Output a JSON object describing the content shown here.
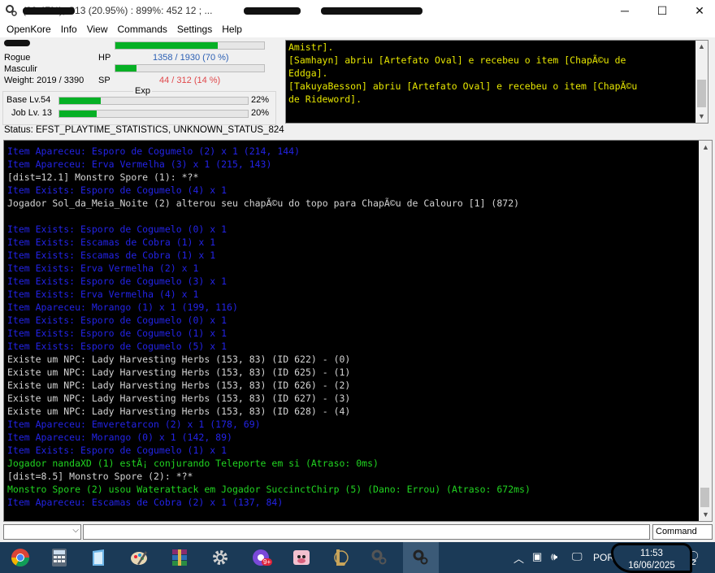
{
  "window": {
    "title": "(22.47%), C13 (20.95%) : 899%: 452 12 ; ...",
    "minimize_glyph": "─",
    "maximize_glyph": "☐",
    "close_glyph": "✕"
  },
  "menu": [
    "OpenKore",
    "Info",
    "View",
    "Commands",
    "Settings",
    "Help"
  ],
  "character": {
    "class": "Rogue",
    "sex": "Masculir",
    "weight": "Weight: 2019 / 3390",
    "hp_label": "HP",
    "hp_text": "1358 / 1930 (70 %)",
    "hp_fraction": 0.7,
    "sp_label": "SP",
    "sp_text": "44 / 312 (14 %)",
    "sp_fraction": 0.14,
    "top_bar_fraction": 0.69,
    "exp_label": "Exp",
    "base_label": "Base Lv.54",
    "base_pct": "22%",
    "base_fraction": 0.22,
    "job_label": "Job Lv. 13",
    "job_pct": "20%",
    "job_fraction": 0.2
  },
  "chat": [
    "Amistr].",
    "[Samhayn] abriu [Artefato Oval] e recebeu o item [ChapÃ©u de",
    "Eddga].",
    "[TakuyaBesson] abriu [Artefato Oval] e recebeu o item [ChapÃ©u",
    "de Rideword]."
  ],
  "status": "Status: EFST_PLAYTIME_STATISTICS, UNKNOWN_STATUS_824",
  "console_lines": [
    {
      "t": "Item Apareceu: Esporo de Cogumelo (2) x 1 (214, 144)",
      "c": "blue"
    },
    {
      "t": "Item Apareceu: Erva Vermelha (3) x 1 (215, 143)",
      "c": "blue"
    },
    {
      "t": "[dist=12.1] Monstro Spore (1): *?*",
      "c": "gray"
    },
    {
      "t": "Item Exists: Esporo de Cogumelo (4) x 1",
      "c": "blue"
    },
    {
      "t": "Jogador Sol_da_Meia_Noite (2) alterou seu chapÃ©u do topo para ChapÃ©u de Calouro [1] (872)",
      "c": "gray"
    },
    {
      "t": "",
      "c": "gray"
    },
    {
      "t": "Item Exists: Esporo de Cogumelo (0) x 1",
      "c": "blue"
    },
    {
      "t": "Item Exists: Escamas de Cobra (1) x 1",
      "c": "blue"
    },
    {
      "t": "Item Exists: Escamas de Cobra (1) x 1",
      "c": "blue"
    },
    {
      "t": "Item Exists: Erva Vermelha (2) x 1",
      "c": "blue"
    },
    {
      "t": "Item Exists: Esporo de Cogumelo (3) x 1",
      "c": "blue"
    },
    {
      "t": "Item Exists: Erva Vermelha (4) x 1",
      "c": "blue"
    },
    {
      "t": "Item Apareceu: Morango (1) x 1 (199, 116)",
      "c": "blue"
    },
    {
      "t": "Item Exists: Esporo de Cogumelo (0) x 1",
      "c": "blue"
    },
    {
      "t": "Item Exists: Esporo de Cogumelo (1) x 1",
      "c": "blue"
    },
    {
      "t": "Item Exists: Esporo de Cogumelo (5) x 1",
      "c": "blue"
    },
    {
      "t": "Existe um NPC: Lady Harvesting Herbs (153, 83) (ID 622) - (0)",
      "c": "gray"
    },
    {
      "t": "Existe um NPC: Lady Harvesting Herbs (153, 83) (ID 625) - (1)",
      "c": "gray"
    },
    {
      "t": "Existe um NPC: Lady Harvesting Herbs (153, 83) (ID 626) - (2)",
      "c": "gray"
    },
    {
      "t": "Existe um NPC: Lady Harvesting Herbs (153, 83) (ID 627) - (3)",
      "c": "gray"
    },
    {
      "t": "Existe um NPC: Lady Harvesting Herbs (153, 83) (ID 628) - (4)",
      "c": "gray"
    },
    {
      "t": "Item Apareceu: Emveretarcon (2) x 1 (178, 69)",
      "c": "blue"
    },
    {
      "t": "Item Apareceu: Morango (0) x 1 (142, 89)",
      "c": "blue"
    },
    {
      "t": "Item Exists: Esporo de Cogumelo (1) x 1",
      "c": "blue"
    },
    {
      "t": "Jogador nandaXD (1) estÃ¡ conjurando Teleporte em si (Atraso: 0ms)",
      "c": "green"
    },
    {
      "t": "[dist=8.5] Monstro Spore (2): *?*",
      "c": "gray"
    },
    {
      "t": "Monstro Spore (2) usou Waterattack em Jogador SuccinctChirp (5) (Dano: Errou) (Atraso: 672ms)",
      "c": "green"
    },
    {
      "t": "Item Apareceu: Escamas de Cobra (2) x 1 (137, 84)",
      "c": "blue"
    }
  ],
  "command_select": "Command",
  "taskbar": {
    "language": "POR",
    "time": "11:53",
    "date": "16/06/2025",
    "notif_count": "2",
    "badge_9plus": "9+"
  },
  "colors": {
    "console_blue": "#2323e6",
    "console_gray": "#d4d4d4",
    "console_green": "#21d421",
    "chat_yellow": "#e6e600",
    "bar_green": "#06b025",
    "taskbar_bg": "#1b3a57"
  }
}
